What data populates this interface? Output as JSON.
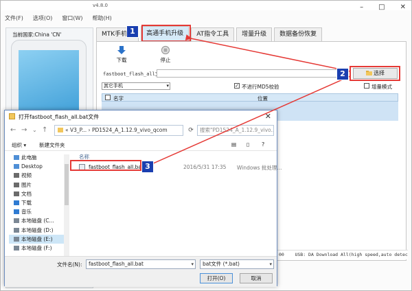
{
  "app": {
    "version": "v4.8.0",
    "menu": [
      "文件(F)",
      "选项(O)",
      "窗口(W)",
      "帮助(H)"
    ],
    "country": "当前国家:China 'CN'",
    "tabs": [
      "MTK手机升",
      "高通手机升级",
      "AT指令工具",
      "增量升级",
      "数据备份恢复"
    ],
    "toolbar": {
      "download_label": "下载",
      "stop_label": "停止"
    },
    "file_label": "fastboot_flash_all文件",
    "choose_label": "选择",
    "phone_select": "其它手机",
    "no_md5_label": "不进行MD5校验",
    "incremental_label": "增量模式",
    "grid_cols": {
      "name": "名字",
      "position": "位置"
    },
    "status_text": "USB: DA Download All(high speed,auto detect)",
    "status_left": "00"
  },
  "dialog": {
    "title": "打开fastboot_flash_all.bat文件",
    "address": {
      "prefix": "«",
      "crumb1": "V3_P...",
      "sep": "›",
      "crumb2": "PD1524_A_1.12.9_vivo_qcom"
    },
    "search_placeholder": "搜索\"PD1524_A_1.12.9_vivo...",
    "toolbar": {
      "organize": "组织 ▾",
      "new_folder": "新建文件夹"
    },
    "tree": [
      {
        "label": "此电脑",
        "icon": "computer-icon",
        "color": "#4f8fd6"
      },
      {
        "label": "Desktop",
        "icon": "desktop-icon",
        "color": "#4f8fd6"
      },
      {
        "label": "视频",
        "icon": "video-icon",
        "color": "#6b6b6b"
      },
      {
        "label": "图片",
        "icon": "picture-icon",
        "color": "#6b6b6b"
      },
      {
        "label": "文档",
        "icon": "document-icon",
        "color": "#6b6b6b"
      },
      {
        "label": "下载",
        "icon": "download-icon",
        "color": "#2f7bd2"
      },
      {
        "label": "音乐",
        "icon": "music-icon",
        "color": "#2f7bd2"
      },
      {
        "label": "本地磁盘 (C...",
        "icon": "drive-icon",
        "color": "#7b8794"
      },
      {
        "label": "本地磁盘 (D:)",
        "icon": "drive-icon",
        "color": "#7b8794"
      },
      {
        "label": "本地磁盘 (E:)",
        "icon": "drive-icon",
        "color": "#7b8794",
        "selected": true
      },
      {
        "label": "本地磁盘 (F:)",
        "icon": "drive-icon",
        "color": "#7b8794"
      }
    ],
    "columns": {
      "name": "名称"
    },
    "file": {
      "name": "fastboot_flash_all.bat",
      "date": "2016/5/31 17:35",
      "type": "Windows 批处理..."
    },
    "filename_label": "文件名(N):",
    "filename_value": "fastboot_flash_all.bat",
    "filter_value": "bat文件 (*.bat)",
    "open_label": "打开(O)",
    "cancel_label": "取消"
  },
  "callouts": [
    "1",
    "2",
    "3"
  ],
  "colors": {
    "highlight": "#e53935",
    "badge": "#1a3fb0",
    "tab_active": "#d6eaf8",
    "grid_header": "#d6e8f7"
  }
}
